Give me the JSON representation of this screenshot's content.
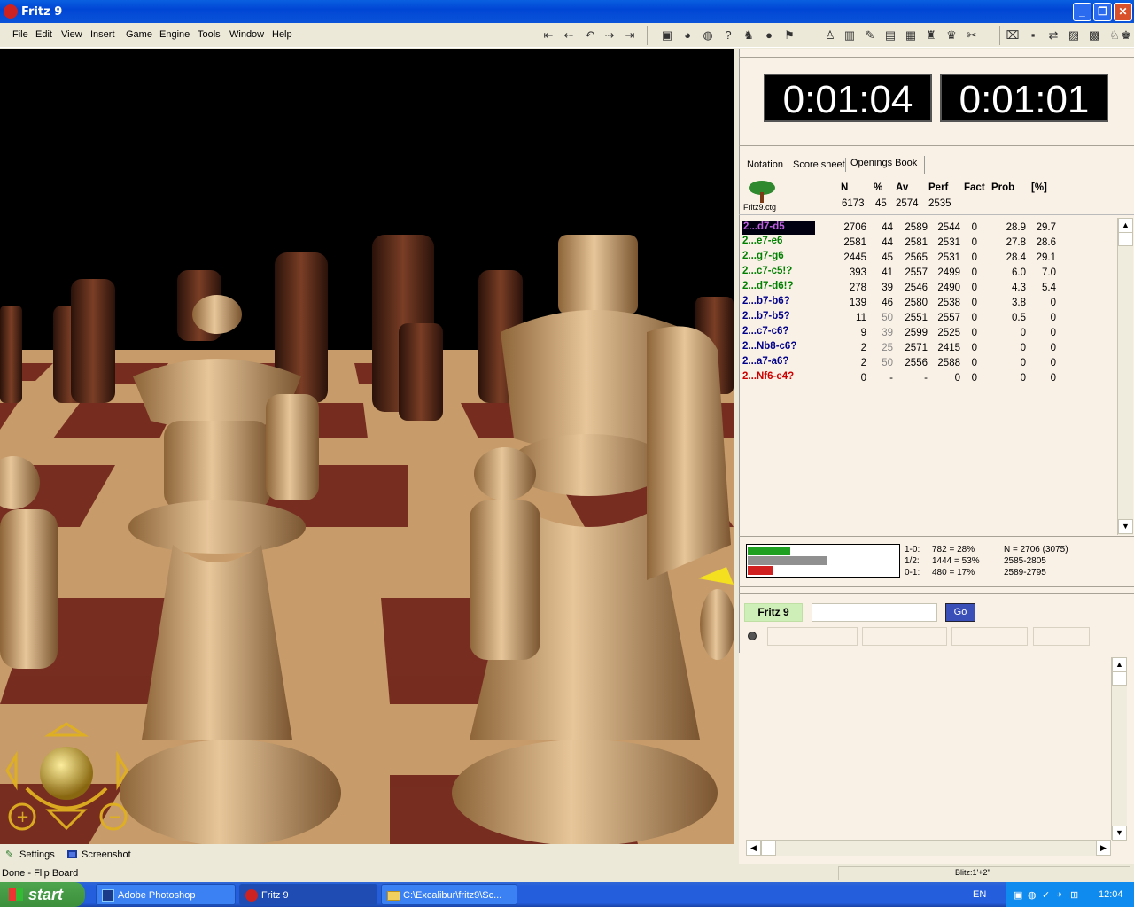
{
  "window": {
    "title": "Fritz 9"
  },
  "menu": [
    "File",
    "Edit",
    "View",
    "Insert",
    "Game",
    "Engine",
    "Tools",
    "Window",
    "Help"
  ],
  "toolbar": {
    "nav_icons": [
      "⇤",
      "⇠",
      "↶",
      "⇢",
      "⇥"
    ],
    "icons": [
      "▣",
      "◕",
      "◍",
      "?",
      "♞",
      "●",
      "⚑",
      "♙",
      "▥",
      "✎",
      "▤",
      "▦",
      "♜",
      "♛",
      "✂",
      "⌧",
      "▪",
      "⇄",
      "▨",
      "▩",
      "♘",
      "♚"
    ]
  },
  "clocks": {
    "white": "0:01:04",
    "black": "0:01:01"
  },
  "tabs": [
    "Notation",
    "Score sheet",
    "Openings Book"
  ],
  "book": {
    "file": "Fritz9.ctg",
    "headers": [
      "N",
      "%",
      "Av",
      "Perf",
      "Fact",
      "Prob",
      "[%]"
    ],
    "totals": [
      "6173",
      "45",
      "2574",
      "2535"
    ],
    "rows": [
      {
        "move": "2...d7-d5",
        "n": "2706",
        "pct": "44",
        "av": "2589",
        "perf": "2544",
        "fact": "0",
        "prob": "28.9",
        "p2": "29.7",
        "color": "#C040C0",
        "selected": true
      },
      {
        "move": "2...e7-e6",
        "n": "2581",
        "pct": "44",
        "av": "2581",
        "perf": "2531",
        "fact": "0",
        "prob": "27.8",
        "p2": "28.6",
        "color": "#008000"
      },
      {
        "move": "2...g7-g6",
        "n": "2445",
        "pct": "45",
        "av": "2565",
        "perf": "2531",
        "fact": "0",
        "prob": "28.4",
        "p2": "29.1",
        "color": "#008000"
      },
      {
        "move": "2...c7-c5!?",
        "n": "393",
        "pct": "41",
        "av": "2557",
        "perf": "2499",
        "fact": "0",
        "prob": "6.0",
        "p2": "7.0",
        "color": "#008000"
      },
      {
        "move": "2...d7-d6!?",
        "n": "278",
        "pct": "39",
        "av": "2546",
        "perf": "2490",
        "fact": "0",
        "prob": "4.3",
        "p2": "5.4",
        "color": "#008000"
      },
      {
        "move": "2...b7-b6?",
        "n": "139",
        "pct": "46",
        "av": "2580",
        "perf": "2538",
        "fact": "0",
        "prob": "3.8",
        "p2": "0",
        "color": "#00008B"
      },
      {
        "move": "2...b7-b5?",
        "n": "11",
        "pct": "50",
        "av": "2551",
        "perf": "2557",
        "fact": "0",
        "prob": "0.5",
        "p2": "0",
        "color": "#00008B"
      },
      {
        "move": "2...c7-c6?",
        "n": "9",
        "pct": "39",
        "av": "2599",
        "perf": "2525",
        "fact": "0",
        "prob": "0",
        "p2": "0",
        "color": "#00008B"
      },
      {
        "move": "2...Nb8-c6?",
        "n": "2",
        "pct": "25",
        "av": "2571",
        "perf": "2415",
        "fact": "0",
        "prob": "0",
        "p2": "0",
        "color": "#00008B"
      },
      {
        "move": "2...a7-a6?",
        "n": "2",
        "pct": "50",
        "av": "2556",
        "perf": "2588",
        "fact": "0",
        "prob": "0",
        "p2": "0",
        "color": "#00008B"
      },
      {
        "move": "2...Nf6-e4?",
        "n": "0",
        "pct": "-",
        "av": "-",
        "perf": "0",
        "fact": "0",
        "prob": "0",
        "p2": "0",
        "color": "#CC0000"
      }
    ]
  },
  "stats": {
    "labels": [
      "1-0:",
      "1/2:",
      "0-1:"
    ],
    "values": [
      "782 = 28%",
      "1444 = 53%",
      "480 = 17%"
    ],
    "fractions": [
      0.28,
      0.53,
      0.17
    ],
    "colors": [
      "#20A020",
      "#909090",
      "#D02020"
    ],
    "right": [
      "N = 2706 (3075)",
      "2585-2805",
      "2589-2795"
    ]
  },
  "engine": {
    "name": "Fritz 9",
    "go_label": "Go"
  },
  "board_panel": {
    "settings_label": "Settings",
    "screenshot_label": "Screenshot"
  },
  "status": {
    "left": "Done - Flip Board",
    "mode": "Blitz:1'+2\""
  },
  "taskbar": {
    "start": "start",
    "tasks": [
      "Adobe Photoshop",
      "Fritz 9",
      "C:\\Excalibur\\fritz9\\Sc..."
    ],
    "lang": "EN",
    "time": "12:04"
  }
}
